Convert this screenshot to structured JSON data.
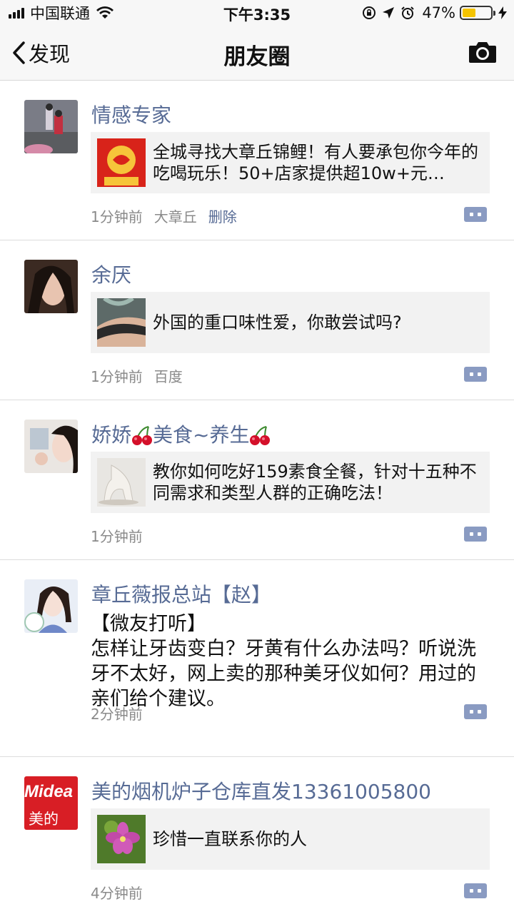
{
  "status_bar": {
    "carrier": "中国联通",
    "time": "下午3:35",
    "battery_percent": "47%",
    "battery_level": 0.47
  },
  "nav": {
    "back_label": "发现",
    "title": "朋友圈"
  },
  "posts": [
    {
      "name": "情感专家",
      "link_title": "全城寻找大章丘锦鲤！有人要承包你今年的吃喝玩乐！50+店家提供超10w+元…",
      "time": "1分钟前",
      "location": "大章丘",
      "delete_label": "删除"
    },
    {
      "name": "余厌",
      "link_title": "外国的重口味性爱，你敢尝试吗?",
      "time": "1分钟前",
      "location": "百度"
    },
    {
      "name_parts": [
        "娇娇",
        "美食~养生"
      ],
      "link_title": "教你如何吃好159素食全餐，针对十五种不同需求和类型人群的正确吃法！",
      "time": "1分钟前"
    },
    {
      "name": "章丘薇报总站【赵】",
      "text_line1": "【微友打听】",
      "text_body": "怎样让牙齿变白？牙黄有什么办法吗？听说洗牙不太好，网上卖的那种美牙仪如何？用过的亲们给个建议。",
      "time": "2分钟前"
    },
    {
      "name": "美的烟机炉子仓库直发13361005800",
      "avatar_text_top": "Midea",
      "avatar_text_bottom": "美的",
      "link_title": "珍惜一直联系你的人",
      "time": "4分钟前"
    }
  ],
  "colors": {
    "name_link": "#576b95",
    "meta_gray": "#8a8a8a",
    "card_bg": "#f2f2f2",
    "comment_btn": "#8a9bc2"
  }
}
